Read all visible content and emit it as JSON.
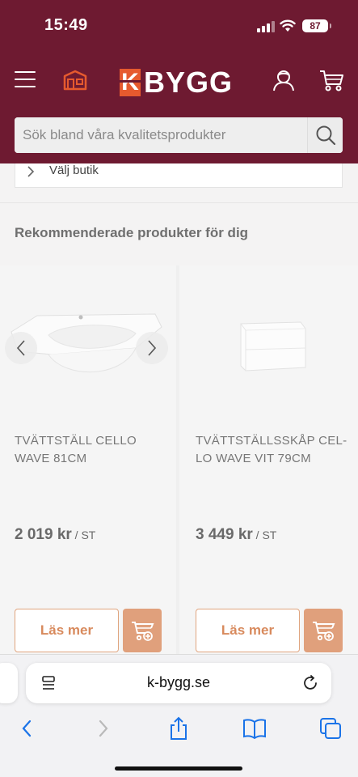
{
  "status_bar": {
    "time": "15:49",
    "battery": "87",
    "icons": [
      "signal-icon",
      "wifi-icon",
      "battery-icon"
    ]
  },
  "header": {
    "logo_k": "K",
    "logo_word": "BYGG",
    "icons": [
      "menu-icon",
      "store-icon",
      "user-icon",
      "cart-icon"
    ],
    "brand_color": "#6e1a31",
    "accent_color": "#e65a2e"
  },
  "search": {
    "placeholder": "Sök bland våra kvalitetsprodukter",
    "icon": "search-icon"
  },
  "store_select": {
    "label": "Välj butik"
  },
  "recommended": {
    "title": "Rekommenderade produkter för dig",
    "products": [
      {
        "name": "TVÄTTSTÄLL CELLO WAVE 81CM",
        "price": "2 019 kr",
        "unit": " / ST",
        "read_more": "Läs mer"
      },
      {
        "name": "TVÄTTSTÄLLSSKÅP CEL-LO WAVE VIT 79CM",
        "price": "3 449 kr",
        "unit": " / ST",
        "read_more": "Läs mer"
      }
    ]
  },
  "browser": {
    "url": "k-bygg.se",
    "toolbar_icons": [
      "back-icon",
      "forward-icon",
      "share-icon",
      "bookmarks-icon",
      "tabs-icon"
    ]
  }
}
